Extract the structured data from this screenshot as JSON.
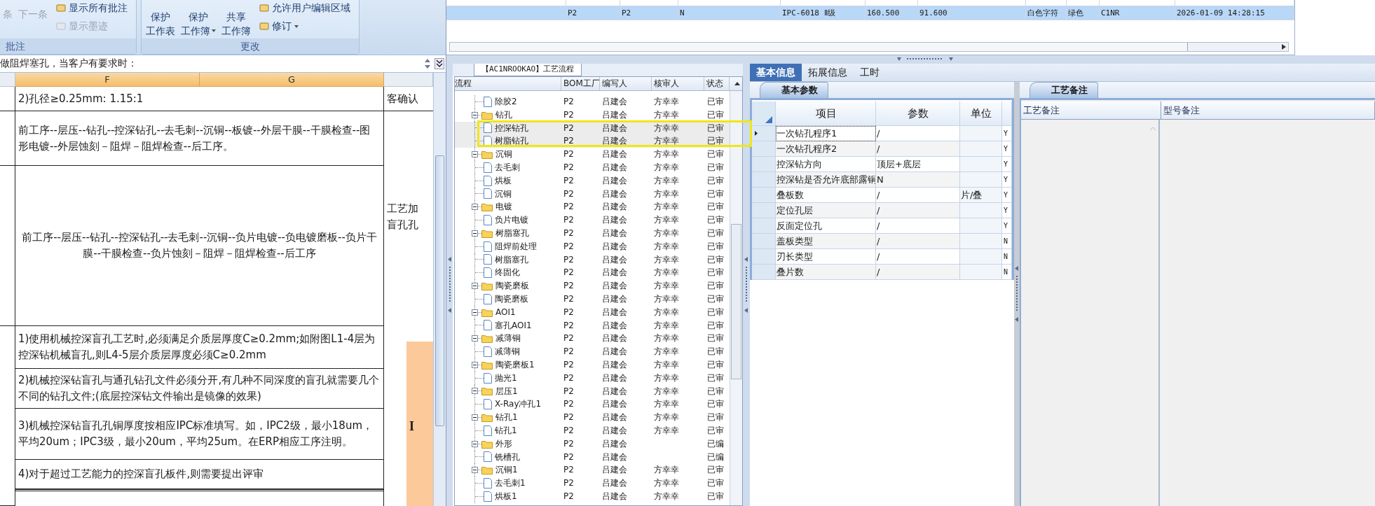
{
  "ribbon": {
    "groups": [
      {
        "label": "批注",
        "large": [
          {
            "lines": [
              "条"
            ],
            "disabled": true,
            "dropdown": false
          },
          {
            "lines": [
              "下一条"
            ],
            "disabled": true,
            "dropdown": false
          }
        ],
        "small": [
          {
            "label": "显示所有批注",
            "disabled": false,
            "dropdown": false
          },
          {
            "label": "显示墨迹",
            "disabled": true,
            "dropdown": false
          }
        ]
      },
      {
        "label": "更改",
        "large": [
          {
            "lines": [
              "保护",
              "工作表"
            ],
            "disabled": false,
            "dropdown": false
          },
          {
            "lines": [
              "保护",
              "工作簿"
            ],
            "disabled": false,
            "dropdown": true
          },
          {
            "lines": [
              "共享",
              "工作簿"
            ],
            "disabled": false,
            "dropdown": false
          }
        ],
        "small": [
          {
            "label": "允许用户编辑区域",
            "disabled": false,
            "dropdown": false
          },
          {
            "label": "修订",
            "disabled": false,
            "dropdown": true
          }
        ]
      }
    ]
  },
  "formula_bar": {
    "value": "做阻焊塞孔，当客户有要求时："
  },
  "sheet": {
    "columns": [
      "F",
      "G"
    ],
    "rows": [
      {
        "text": "2)孔径≥0.25mm:    1.15:1",
        "side": [
          "客确认"
        ]
      },
      {
        "text": "前工序--层压--钻孔--控深钻孔--去毛刺--沉铜--板镀--外层干膜--干膜检查--图形电镀--外层蚀刻－阻焊－阻焊检查--后工序。"
      },
      {
        "text": "前工序--层压--钻孔--控深钻孔--去毛刺--沉铜--负片电镀--负电镀磨板--负片干膜--干膜检查--负片蚀刻－阻焊－阻焊检查--后工序",
        "side": [
          "工艺加",
          "盲孔孔"
        ]
      },
      {
        "text": "1)使用机械控深盲孔工艺时,必须满足介质层厚度C≥0.2mm;如附图L1-4层为控深钻机械盲孔,则L4-5层介质层厚度必须C≥0.2mm"
      },
      {
        "text": "2)机械控深钻盲孔与通孔钻孔文件必须分开,有几种不同深度的盲孔就需要几个不同的钻孔文件;(底层控深钻文件输出是镜像的效果)"
      },
      {
        "text": "3)机械控深钻盲孔孔铜厚度按相应IPC标准填写。如，IPC2级，最小18um，平均20um；IPC3级，最小20um，平均25um。在ERP相应工序注明。"
      },
      {
        "text": "4)对于超过工艺能力的控深盲孔板件,则需要提出评审"
      }
    ],
    "figure_text": "I"
  },
  "top_grid": {
    "rows": [
      {
        "selected": true,
        "cells": [
          "P2",
          "P2",
          "N",
          "IPC-6018 Ⅱ级",
          "160.500",
          "91.600",
          "白色字符",
          "绿色",
          "C1NR",
          "2026-01-09 14:28:15"
        ]
      }
    ]
  },
  "tree": {
    "tab": "【AC1NROOKAO】工艺流程",
    "columns": [
      "流程",
      "BOM工厂",
      "编写人",
      "核审人",
      "状态"
    ],
    "items": [
      {
        "kind": "file",
        "name": "除胶2",
        "bom": "P2",
        "writer": "吕建会",
        "reviewer": "方幸幸",
        "status": "已审",
        "selected": false
      },
      {
        "kind": "folder",
        "name": "钻孔",
        "bom": "P2",
        "writer": "吕建会",
        "reviewer": "方幸幸",
        "status": "已审",
        "selected": false,
        "expanded": true,
        "children": [
          {
            "kind": "file",
            "name": "控深钻孔",
            "bom": "P2",
            "writer": "吕建会",
            "reviewer": "方幸幸",
            "status": "已审",
            "selected": true
          },
          {
            "kind": "file",
            "name": "树脂钻孔",
            "bom": "P2",
            "writer": "吕建会",
            "reviewer": "方幸幸",
            "status": "已审",
            "selected": true
          }
        ]
      },
      {
        "kind": "folder",
        "name": "沉铜",
        "bom": "P2",
        "writer": "吕建会",
        "reviewer": "方幸幸",
        "status": "已审",
        "selected": false,
        "expanded": true,
        "children": [
          {
            "kind": "file",
            "name": "去毛刺",
            "bom": "P2",
            "writer": "吕建会",
            "reviewer": "方幸幸",
            "status": "已审",
            "selected": false
          },
          {
            "kind": "file",
            "name": "烘板",
            "bom": "P2",
            "writer": "吕建会",
            "reviewer": "方幸幸",
            "status": "已审",
            "selected": false
          },
          {
            "kind": "file",
            "name": "沉铜",
            "bom": "P2",
            "writer": "吕建会",
            "reviewer": "方幸幸",
            "status": "已审",
            "selected": false
          }
        ]
      },
      {
        "kind": "folder",
        "name": "电镀",
        "bom": "P2",
        "writer": "吕建会",
        "reviewer": "方幸幸",
        "status": "已审",
        "selected": false,
        "expanded": true,
        "children": [
          {
            "kind": "file",
            "name": "负片电镀",
            "bom": "P2",
            "writer": "吕建会",
            "reviewer": "方幸幸",
            "status": "已审",
            "selected": false
          }
        ]
      },
      {
        "kind": "folder",
        "name": "树脂塞孔",
        "bom": "P2",
        "writer": "吕建会",
        "reviewer": "方幸幸",
        "status": "已审",
        "selected": false,
        "expanded": true,
        "children": [
          {
            "kind": "file",
            "name": "阻焊前处理",
            "bom": "P2",
            "writer": "吕建会",
            "reviewer": "方幸幸",
            "status": "已审",
            "selected": false
          },
          {
            "kind": "file",
            "name": "树脂塞孔",
            "bom": "P2",
            "writer": "吕建会",
            "reviewer": "方幸幸",
            "status": "已审",
            "selected": false
          },
          {
            "kind": "file",
            "name": "终固化",
            "bom": "P2",
            "writer": "吕建会",
            "reviewer": "方幸幸",
            "status": "已审",
            "selected": false
          }
        ]
      },
      {
        "kind": "folder",
        "name": "陶瓷磨板",
        "bom": "P2",
        "writer": "吕建会",
        "reviewer": "方幸幸",
        "status": "已审",
        "selected": false,
        "expanded": true,
        "children": [
          {
            "kind": "file",
            "name": "陶瓷磨板",
            "bom": "P2",
            "writer": "吕建会",
            "reviewer": "方幸幸",
            "status": "已审",
            "selected": false
          }
        ]
      },
      {
        "kind": "folder",
        "name": "AOI1",
        "bom": "P2",
        "writer": "吕建会",
        "reviewer": "方幸幸",
        "status": "已审",
        "selected": false,
        "expanded": true,
        "children": [
          {
            "kind": "file",
            "name": "塞孔AOI1",
            "bom": "P2",
            "writer": "吕建会",
            "reviewer": "方幸幸",
            "status": "已审",
            "selected": false
          }
        ]
      },
      {
        "kind": "folder",
        "name": "减薄铜",
        "bom": "P2",
        "writer": "吕建会",
        "reviewer": "方幸幸",
        "status": "已审",
        "selected": false,
        "expanded": true,
        "children": [
          {
            "kind": "file",
            "name": "减薄铜",
            "bom": "P2",
            "writer": "吕建会",
            "reviewer": "方幸幸",
            "status": "已审",
            "selected": false
          }
        ]
      },
      {
        "kind": "folder",
        "name": "陶瓷磨板1",
        "bom": "P2",
        "writer": "吕建会",
        "reviewer": "方幸幸",
        "status": "已审",
        "selected": false,
        "expanded": true,
        "children": [
          {
            "kind": "file",
            "name": "抛光1",
            "bom": "P2",
            "writer": "吕建会",
            "reviewer": "方幸幸",
            "status": "已审",
            "selected": false
          }
        ]
      },
      {
        "kind": "folder",
        "name": "层压1",
        "bom": "P2",
        "writer": "吕建会",
        "reviewer": "方幸幸",
        "status": "已审",
        "selected": false,
        "expanded": true,
        "children": [
          {
            "kind": "file",
            "name": "X-Ray冲孔1",
            "bom": "P2",
            "writer": "吕建会",
            "reviewer": "方幸幸",
            "status": "已审",
            "selected": false
          }
        ]
      },
      {
        "kind": "folder",
        "name": "钻孔1",
        "bom": "P2",
        "writer": "吕建会",
        "reviewer": "方幸幸",
        "status": "已审",
        "selected": false,
        "expanded": true,
        "children": [
          {
            "kind": "file",
            "name": "钻孔1",
            "bom": "P2",
            "writer": "吕建会",
            "reviewer": "方幸幸",
            "status": "已审",
            "selected": false
          }
        ]
      },
      {
        "kind": "folder",
        "name": "外形",
        "bom": "P2",
        "writer": "吕建会",
        "status": "已编",
        "selected": false,
        "expanded": true,
        "children": [
          {
            "kind": "file",
            "name": "铣槽孔",
            "bom": "P2",
            "writer": "吕建会",
            "status": "已编",
            "selected": false
          }
        ]
      },
      {
        "kind": "folder",
        "name": "沉铜1",
        "bom": "P2",
        "writer": "吕建会",
        "reviewer": "方幸幸",
        "status": "已审",
        "selected": false,
        "expanded": true,
        "children": [
          {
            "kind": "file",
            "name": "去毛刺1",
            "bom": "P2",
            "writer": "吕建会",
            "reviewer": "方幸幸",
            "status": "已审",
            "selected": false
          },
          {
            "kind": "file",
            "name": "烘板1",
            "bom": "P2",
            "writer": "吕建会",
            "reviewer": "方幸幸",
            "status": "已审",
            "selected": false
          }
        ]
      }
    ]
  },
  "detail_tabs": [
    {
      "label": "基本信息",
      "selected": true
    },
    {
      "label": "拓展信息",
      "selected": false
    },
    {
      "label": "工时",
      "selected": false
    }
  ],
  "params": {
    "tab": "基本参数",
    "columns": [
      "项目",
      "参数",
      "单位"
    ],
    "rows": [
      {
        "item": "一次钻孔程序1",
        "value": "/",
        "flag": "Y",
        "selected": true
      },
      {
        "item": "一次钻孔程序2",
        "value": "/",
        "flag": "Y",
        "selected": false
      },
      {
        "item": "控深钻方向",
        "value": "顶层+底层",
        "flag": "Y",
        "selected": false
      },
      {
        "item": "控深钻是否允许底部露铜",
        "value": "N",
        "flag": "Y",
        "selected": false
      },
      {
        "item": "叠板数",
        "value": "/",
        "unit": "片/叠",
        "flag": "Y",
        "selected": false
      },
      {
        "item": "定位孔层",
        "value": "/",
        "flag": "Y",
        "selected": false
      },
      {
        "item": "反面定位孔",
        "value": "/",
        "flag": "Y",
        "selected": false
      },
      {
        "item": "盖板类型",
        "value": "/",
        "flag": "N",
        "selected": false
      },
      {
        "item": "刃长类型",
        "value": "/",
        "flag": "N",
        "selected": false
      },
      {
        "item": "叠片数",
        "value": "/",
        "flag": "N",
        "selected": false
      }
    ]
  },
  "notes": {
    "tab": "工艺备注",
    "columns": [
      "工艺备注",
      "型号备注"
    ]
  }
}
